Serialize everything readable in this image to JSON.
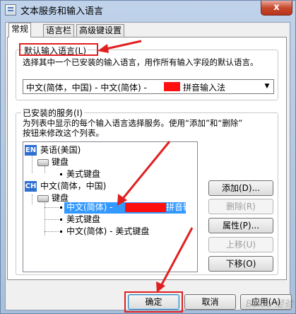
{
  "window": {
    "title": "文本服务和输入语言",
    "close_symbol": "x"
  },
  "tabs": [
    "常规",
    "语言栏",
    "高级键设置"
  ],
  "default_input": {
    "title": "默认输入语言(L)",
    "description": "选择其中一个已安装的输入语言，用作所有输入字段的默认语言。",
    "selected_prefix": "中文(简体，中国) - 中文(简体) -",
    "selected_suffix": "拼音输入法"
  },
  "installed_services": {
    "title": "已安装的服务(I)",
    "description_line1": "为列表中显示的每个输入语言选择服务。使用“添加”和“删除”",
    "description_line2": "按钮来修改这个列表。",
    "tree": {
      "en_badge": "EN",
      "en_language": "英语(美国)",
      "en_keyboard_group": "键盘",
      "en_keyboard": "美式键盘",
      "ch_badge": "CH",
      "ch_language": "中文(简体，中国)",
      "ch_keyboard_group": "键盘",
      "ch_service_selected_prefix": "中文(简体) -",
      "ch_service_selected_suffix": "拼音输入法",
      "ch_service_2": "美式键盘",
      "ch_service_3": "中文(简体) - 美式键盘"
    }
  },
  "side_buttons": {
    "add": "添加(D)...",
    "remove": "删除(R)",
    "properties": "属性(P)...",
    "move_up": "上移(U)",
    "move_down": "下移(O)"
  },
  "footer_buttons": {
    "ok": "确定",
    "cancel": "取消",
    "apply": "应用(A)"
  },
  "watermark": "Baidu 经验",
  "colors": {
    "selection": "#3399ff",
    "annotation_red": "#e02020",
    "redaction": "#ff1010"
  }
}
